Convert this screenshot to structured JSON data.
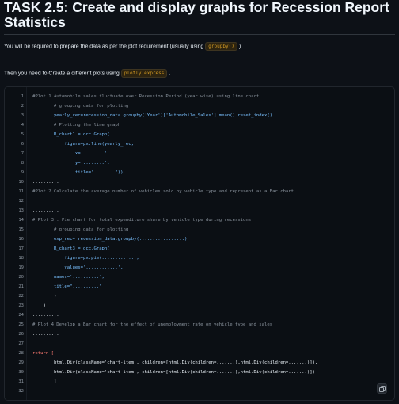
{
  "task": {
    "title": "TASK 2.5: Create and display graphs for Recession Report Statistics",
    "instruction_1_prefix": "You will be required to prepare the data as per the plot requirement (usually using",
    "instruction_1_chip": "groupby()",
    "instruction_1_suffix": ")",
    "instruction_2_prefix": "Then you need to Create a different plots using",
    "instruction_2_chip": "plotly.express",
    "instruction_2_suffix": "."
  },
  "editor": {
    "line_numbers": [
      "1",
      "2",
      "3",
      "4",
      "5",
      "6",
      "7",
      "8",
      "9",
      "10",
      "11",
      "12",
      "13",
      "14",
      "15",
      "16",
      "17",
      "18",
      "19",
      "20",
      "21",
      "22",
      "23",
      "24",
      "25",
      "26",
      "27",
      "28",
      "29",
      "30",
      "31",
      "32"
    ],
    "lines": [
      "#Plot 1 Automobile sales fluctuate over Recession Period (year wise) using line chart",
      "        # grouping data for plotting",
      "        yearly_rec=recession_data.groupby('Year')['Automobile_Sales'].mean().reset_index()",
      "        # Plotting the line graph",
      "        R_chart1 = dcc.Graph(",
      "            figure=px.line(yearly_rec,",
      "                x='........',",
      "                y='........',",
      "                title=\"........\"))",
      "..........",
      "#Plot 2 Calculate the average number of vehicles sold by vehicle type and represent as a Bar chart",
      "",
      "..........",
      "# Plot 3 : Pie chart for total expenditure share by vehicle type during recessions",
      "        # grouping data for plotting",
      "        exp_rec= recession_data.groupby(.................)",
      "        R_chart3 = dcc.Graph(",
      "            figure=px.pie(.............,",
      "            values='............',",
      "        names='..........',",
      "        title=\"..........\"",
      "        )",
      "    )",
      "..........",
      "# Plot 4 Develop a Bar chart for the effect of unemployment rate on vehicle type and sales",
      "..........",
      "",
      "return [",
      "        html.Div(className='chart-item', children=[html.Div(children=.......),html.Div(children=.......)]),",
      "        html.Div(className='chart-item', children=[html.Div(children=.......),html.Div(children=.......)])",
      "        ]",
      ""
    ],
    "copy_icon": "copy-icon"
  }
}
